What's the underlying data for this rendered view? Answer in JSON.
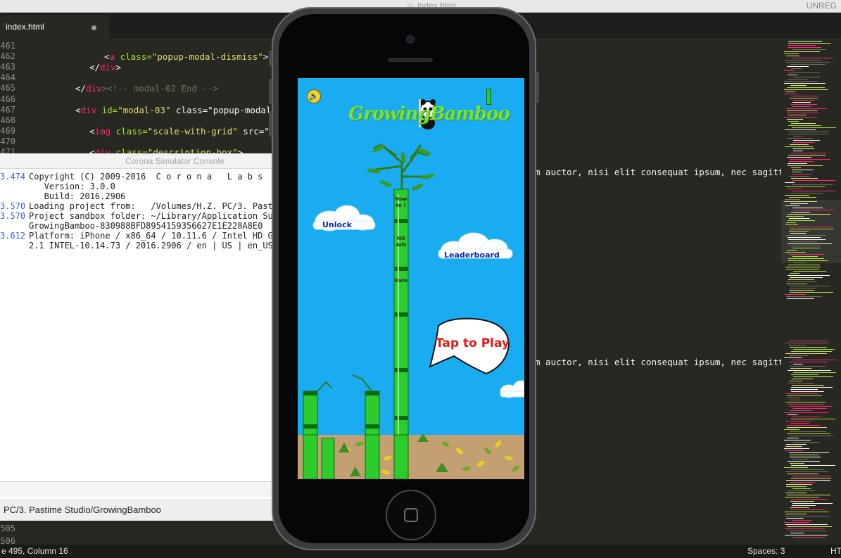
{
  "editor": {
    "window_title": "index.html",
    "unregistered": "UNREG",
    "tab_label": "index.html",
    "gutter_top": [
      "461",
      "462",
      "463",
      "464",
      "465",
      "466",
      "467",
      "468",
      "469",
      "470",
      "471"
    ],
    "code_lines": [
      {
        "pre": "<",
        "tag": "a",
        "attr": " class=",
        "str": "\"popup-modal-dismiss\"",
        "post": ">Clo"
      },
      {
        "pre": "</",
        "tag": "div",
        "attr": "",
        "str": "",
        "post": ">"
      },
      {
        "pre": "",
        "tag": "",
        "attr": "",
        "str": "",
        "post": ""
      },
      {
        "pre": "</",
        "tag": "div",
        "attr": "",
        "str": "",
        "post": "><!-- modal-02 End -->"
      },
      {
        "pre": "",
        "tag": "",
        "attr": "",
        "str": "",
        "post": ""
      },
      {
        "pre": "<",
        "tag": "div",
        "attr": " id=",
        "str": "\"modal-03\"",
        "post": " class=\"popup-modal mf"
      },
      {
        "pre": "",
        "tag": "",
        "attr": "",
        "str": "",
        "post": ""
      },
      {
        "pre": "<",
        "tag": "img",
        "attr": " class=",
        "str": "\"scale-with-grid\"",
        "post": " src=\"im"
      },
      {
        "pre": "",
        "tag": "",
        "attr": "",
        "str": "",
        "post": ""
      },
      {
        "pre": "<",
        "tag": "div",
        "attr": " class=",
        "str": "\"description-box\"",
        "post": ">"
      }
    ],
    "gutter_bottom": [
      "505",
      "506"
    ],
    "lorem_1": "m auctor, nisi elit consequat ipsum, nec sagittis",
    "lorem_2": "m auctor, nisi elit consequat ipsum, nec sagittis",
    "status_left": "e 495, Column 16",
    "status_spaces": "Spaces: 3",
    "status_right": "HT"
  },
  "console": {
    "title": "Corona Simulator Console",
    "lines": [
      {
        "ts": "3.474",
        "text": "Copyright (C) 2009-2016  C o r o n a   L a b s"
      },
      {
        "ts": "",
        "text": "   Version: 3.0.0"
      },
      {
        "ts": "",
        "text": "   Build: 2016.2906"
      },
      {
        "ts": "3.570",
        "text": "Loading project from:   /Volumes/H.Z. PC/3. Past"
      },
      {
        "ts": "3.570",
        "text": "Project sandbox folder: ~/Library/Application Su"
      },
      {
        "ts": "",
        "text": "GrowingBamboo-830988BFD8954159356627E1E228A8E0"
      },
      {
        "ts": "3.612",
        "text": "Platform: iPhone / x86_64 / 10.11.6 / Intel HD G"
      },
      {
        "ts": "",
        "text": "2.1 INTEL-10.14.73 / 2016.2906 / en | US | en_US"
      }
    ],
    "path": "PC/3. Pastime Studio/GrowingBamboo"
  },
  "game": {
    "logo": "GrowingBamboo",
    "unlock": "Unlock",
    "leaderboard": "Leaderboard",
    "how_to": "How to ?",
    "no_ads": "NO Ads",
    "rate": "Rate",
    "tap_to_play": "Tap to Play"
  },
  "colors": {
    "sky": "#1aacf0",
    "ground": "#c49f72",
    "bamboo": "#2ccc2c",
    "editor_bg": "#272822"
  }
}
